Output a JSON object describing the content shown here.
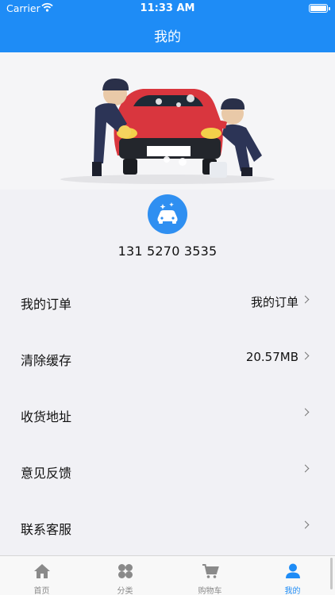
{
  "status_bar": {
    "carrier": "Carrier",
    "time": "11:33 AM"
  },
  "nav": {
    "title": "我的"
  },
  "profile": {
    "phone": "131 5270 3535",
    "avatar_icon": "car-wash-icon"
  },
  "menu": [
    {
      "label": "我的订单",
      "value": "我的订单"
    },
    {
      "label": "清除缓存",
      "value": "20.57MB"
    },
    {
      "label": "收货地址",
      "value": ""
    },
    {
      "label": "意见反馈",
      "value": ""
    },
    {
      "label": "联系客服",
      "value": ""
    }
  ],
  "tabbar": {
    "items": [
      {
        "label": "首页",
        "icon": "home-icon"
      },
      {
        "label": "分类",
        "icon": "category-icon"
      },
      {
        "label": "购物车",
        "icon": "cart-icon"
      },
      {
        "label": "我的",
        "icon": "person-icon",
        "active": true
      }
    ]
  },
  "colors": {
    "primary": "#1e8cf6",
    "background": "#f1f1f5",
    "tab_inactive": "#8a8a8a"
  }
}
